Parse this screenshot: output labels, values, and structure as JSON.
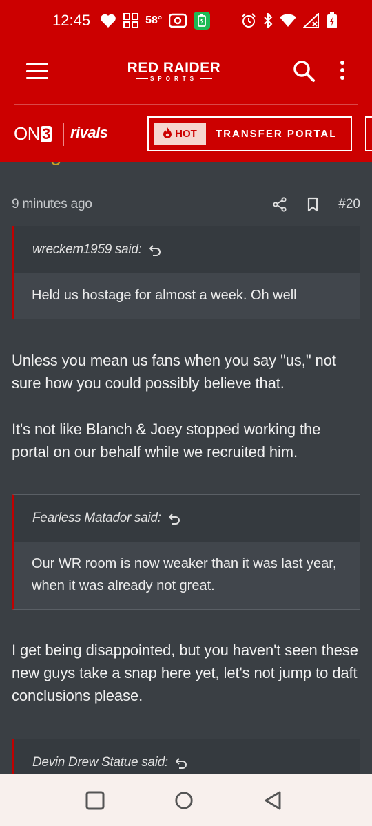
{
  "status_bar": {
    "time": "12:45",
    "temperature": "58°",
    "icons": [
      "heart-icon",
      "grid-app-icon",
      "cast-icon",
      "battery-saver-icon",
      "alarm-icon",
      "bluetooth-icon",
      "wifi-icon",
      "signal-icon",
      "battery-icon"
    ]
  },
  "header": {
    "brand_main": "RED RAIDER",
    "brand_sub": "SPORTS",
    "accent_color": "#cc0000"
  },
  "partner_bar": {
    "on3_text": "ON",
    "on3_num": "3",
    "rivals_text": "rivals",
    "hot_badge": "HOT",
    "hot_label": "TRANSFER PORTAL"
  },
  "post": {
    "time": "9 minutes ago",
    "number": "#20",
    "blocks": [
      {
        "type": "quote",
        "author": "wreckem1959 said:",
        "text": "Held us hostage for almost a week. Oh well"
      },
      {
        "type": "text",
        "text": "Unless you mean us fans when you say \"us,\" not sure how you could possibly believe that."
      },
      {
        "type": "text",
        "text": "It's not like Blanch & Joey stopped working the portal on our behalf while we recruited him."
      },
      {
        "type": "quote",
        "author": "Fearless Matador said:",
        "text": "Our WR room is now weaker than it was last year, when it was already not great."
      },
      {
        "type": "text",
        "text": "I get being disappointed, but you haven't seen these new guys take a snap here yet, let's not jump to daft conclusions please."
      },
      {
        "type": "quote",
        "author": "Devin Drew Statue said:",
        "text": ""
      }
    ]
  }
}
